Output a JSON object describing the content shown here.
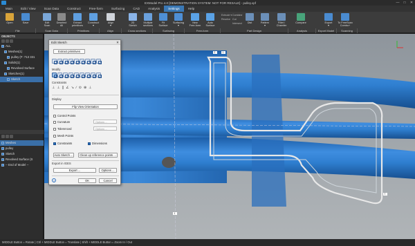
{
  "window": {
    "title": "EXModel Pro 4.0 [DEMONSTRATION SYSTEM: NOT FOR RESALE] - pulley.xpf",
    "buttons": [
      "—",
      "□",
      "✕"
    ]
  },
  "menu_tabs": [
    {
      "label": "Main",
      "active": false
    },
    {
      "label": "Edit / View",
      "active": false
    },
    {
      "label": "Scan Data",
      "active": false
    },
    {
      "label": "Construct",
      "active": false
    },
    {
      "label": "Free-form",
      "active": false
    },
    {
      "label": "Surfacing",
      "active": false
    },
    {
      "label": "CAD",
      "active": false
    },
    {
      "label": "Analysis",
      "active": false
    },
    {
      "label": "Settings",
      "active": true
    },
    {
      "label": "Help",
      "active": false
    }
  ],
  "ribbon": {
    "buttons": [
      {
        "label": "Open",
        "icon": "folder-icon",
        "color": "#d9a43a"
      },
      {
        "label": "Save",
        "icon": "floppy-icon",
        "color": "#4a8bd0"
      },
      {
        "label": "Edit\nScan",
        "icon": "scan-icon",
        "color": "#7aa7d8"
      },
      {
        "label": "Deselect\nAll",
        "icon": "deselect-icon",
        "color": "#8a8a8a"
      },
      {
        "label": "Extract\nprimitives",
        "icon": "primitives-icon",
        "color": "#5f9fe0"
      },
      {
        "label": "Construct\n▾",
        "icon": "construct-icon",
        "color": "#5f9fe0"
      },
      {
        "label": "Align\n▾",
        "icon": "align-icon",
        "color": "#d0d4da"
      },
      {
        "label": "2D\nSketch",
        "icon": "sketch-2d-icon",
        "color": "#8ab4e8"
      },
      {
        "label": "Multiple\nsections",
        "icon": "sections-icon",
        "color": "#6aa0dc"
      },
      {
        "label": "Fit\nSurface",
        "icon": "fit-surface-icon",
        "color": "#4e8fd6"
      },
      {
        "label": "Surfacing\n▾",
        "icon": "surfacing-icon",
        "color": "#4e8fd6"
      },
      {
        "label": "New\nFree-form",
        "icon": "freeform-icon",
        "color": "#5aa2e6"
      },
      {
        "label": "Auto\nSurface",
        "icon": "auto-surface-icon",
        "color": "#5aa2e6"
      },
      {
        "label": "Dist",
        "icon": "dist-icon",
        "color": "#6b8fb8"
      },
      {
        "label": "Pattern\n▾",
        "icon": "pattern-icon",
        "color": "#6b8fb8"
      },
      {
        "label": "Fillet /\nChamfer",
        "icon": "fillet-icon",
        "color": "#6b8fb8"
      },
      {
        "label": "Compare",
        "icon": "compare-icon",
        "color": "#48a37a"
      },
      {
        "label": "Export\n▾",
        "icon": "export-icon",
        "color": "#4a8bd0"
      },
      {
        "label": "To FreeScan\nCombo+",
        "icon": "freescan-icon",
        "color": "#4a8bd0"
      }
    ],
    "small_options": [
      "Extrude ▾",
      "Revolve",
      "Combine",
      "Cut",
      "Intersect"
    ],
    "groups": [
      "File",
      "Scan Data",
      "Primitives",
      "Align",
      "Cross sections",
      "Surfacing",
      "Free-form",
      "Part Design",
      "Analysis",
      "Export Model",
      "Scanning"
    ]
  },
  "objects_panel": {
    "title": "OBJECTS",
    "items": [
      {
        "label": "ALL",
        "indent": 0,
        "selected": false
      },
      {
        "label": "Meshes(1)",
        "indent": 1,
        "selected": false
      },
      {
        "label": "pulley (F: 713 331",
        "indent": 2,
        "selected": false
      },
      {
        "label": "Solids(1)",
        "indent": 1,
        "selected": false
      },
      {
        "label": "Revolved Surface",
        "indent": 2,
        "selected": false
      },
      {
        "label": "Sketches(1)",
        "indent": 1,
        "selected": false
      },
      {
        "label": "Sketch",
        "indent": 2,
        "selected": true
      }
    ]
  },
  "history_panel": {
    "items": [
      {
        "label": "Meshes",
        "selected": true
      },
      {
        "label": "pulley",
        "selected": false
      },
      {
        "label": "Sketch",
        "selected": false
      },
      {
        "label": "Revolved Surface (S",
        "selected": false
      },
      {
        "label": "-- End of Model --",
        "selected": false
      }
    ]
  },
  "dialog": {
    "title": "Edit Sketch",
    "close": "✕",
    "extract_button": "Extract primitives",
    "modify_label": "Modify",
    "constraints_label": "Constraints",
    "constraint_glyphs": [
      "⊥",
      "⊥",
      "∥",
      "∠",
      "↘",
      "∕",
      "⊙",
      "⊕",
      "⊥"
    ],
    "display_label": "Display",
    "flip_button": "Flip View Orientation",
    "checkboxes": [
      {
        "label": "Control Points",
        "checked": false
      },
      {
        "label": "Curvature",
        "checked": false
      },
      {
        "label": "Tolerenced",
        "checked": false
      },
      {
        "label": "Mesh Points",
        "checked": false
      },
      {
        "label": "Constraints",
        "checked": true
      },
      {
        "label": "Dimensions",
        "checked": true
      }
    ],
    "options_placeholder": "Options ...",
    "auto_sketch_button": "Auto Sketch ...",
    "clean_up_button": "Clean up reference points ...",
    "export_label": "Export in IGES",
    "export_button": "Export ...",
    "options_button": "Options ...",
    "help": "?",
    "ok_button": "OK",
    "cancel_button": "Cancel"
  },
  "viewport": {
    "tags": [
      "2",
      "1",
      "1",
      "7"
    ],
    "colors": {
      "part": "#2f7fd0",
      "part_dark": "#1c5ea8",
      "sketch": "#e8e8e8"
    }
  },
  "statusbar": {
    "text": "MIDDLE Button = Rotate | Ctrl + MIDDLE Button = Translate | Shift + MIDDLE Button = Zoom In / Out"
  }
}
